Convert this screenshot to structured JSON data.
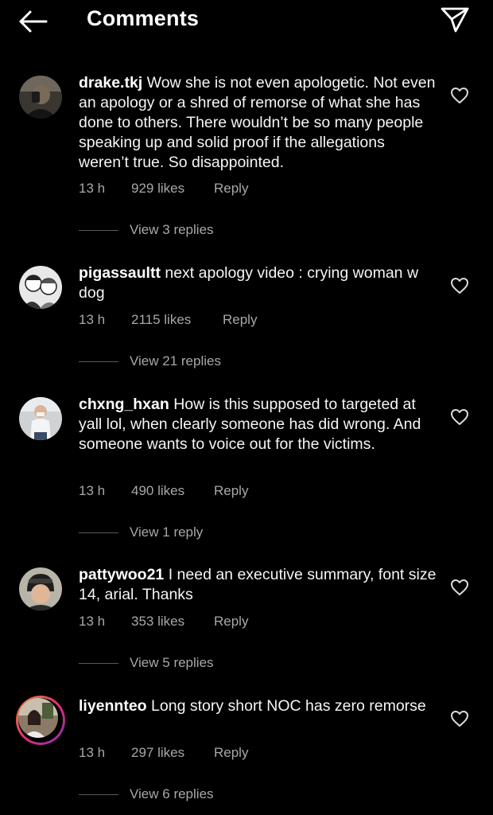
{
  "header": {
    "title": "Comments",
    "back_icon": "arrow-left-icon",
    "share_icon": "paper-plane-icon"
  },
  "comments": [
    {
      "username": "drake.tkj",
      "text": "Wow she is not even apologetic. Not even an apology or a shred of remorse of what she has done to others. There wouldn’t be so many people speaking up and solid proof if the allegations weren’t true. So disappointed.",
      "time": "13 h",
      "likes": "929 likes",
      "reply": "Reply",
      "view_replies": "View 3 replies"
    },
    {
      "username": "pigassaultt",
      "text": "next apology video : crying woman w dog",
      "time": "13 h",
      "likes": "2115 likes",
      "reply": "Reply",
      "view_replies": "View 21 replies"
    },
    {
      "username": "chxng_hxan",
      "text": "How is this supposed to targeted at yall lol, when clearly someone has did wrong. And someone wants to voice out for the victims.",
      "time": "13 h",
      "likes": "490 likes",
      "reply": "Reply",
      "view_replies": "View 1 reply"
    },
    {
      "username": "pattywoo21",
      "text": "I need an executive summary, font size 14, arial. Thanks",
      "time": "13 h",
      "likes": "353 likes",
      "reply": "Reply",
      "view_replies": "View 5 replies"
    },
    {
      "username": "liyennteo",
      "text": "Long story short NOC has zero remorse",
      "time": "13 h",
      "likes": "297 likes",
      "reply": "Reply",
      "view_replies": "View 6 replies"
    }
  ],
  "colors": {
    "background": "#000000",
    "text": "#f5f5f5",
    "secondary": "#a8a8a8",
    "story_ring": "#dd2a7b"
  }
}
